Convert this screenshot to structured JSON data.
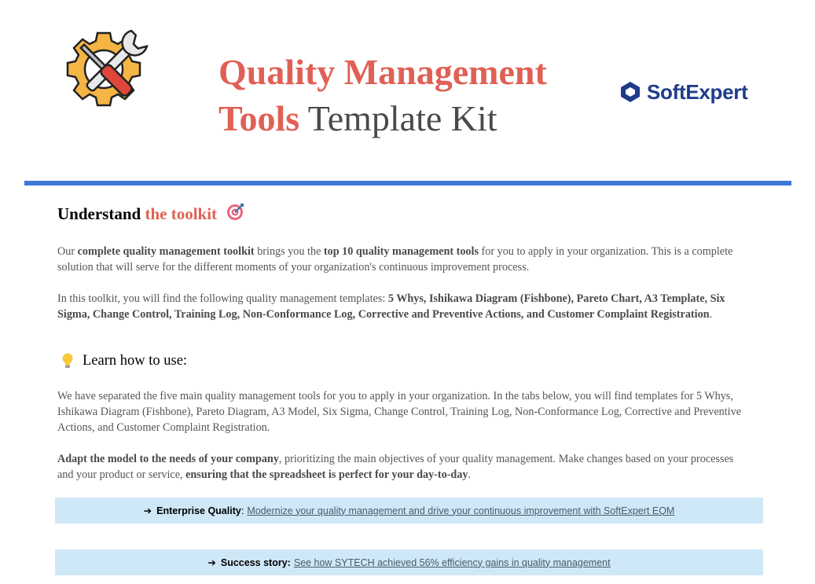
{
  "header": {
    "title_line1_red": "Quality Management",
    "title_line2_red": "Tools",
    "title_line2_gray": " Template Kit",
    "brand": "SoftExpert",
    "logo_icon": "gear-wrench-screwdriver-icon",
    "brand_icon": "softexpert-hexagon-icon"
  },
  "colors": {
    "accent_red": "#e06055",
    "divider_blue": "#3c78d8",
    "cta_bg": "#cfe8f7",
    "brand_blue": "#1f3c8a"
  },
  "section1": {
    "heading_black": "Understand ",
    "heading_red": "the toolkit",
    "heading_icon": "target-icon"
  },
  "p1": {
    "t1": "Our ",
    "b1": "complete quality management toolkit",
    "t2": " brings you the ",
    "b2": "top 10 quality management tools",
    "t3": " for you to apply in your organization. This is a complete solution that will serve for the different moments of your organization's continuous improvement process."
  },
  "p2": {
    "t1": "In this toolkit, you will find the following quality management templates: ",
    "b1": "5 Whys, Ishikawa Diagram (Fishbone), Pareto Chart, A3 Template, Six Sigma, Change Control, Training Log, Non-Conformance Log, Corrective and Preventive Actions, and Customer Complaint Registration",
    "t2": "."
  },
  "howto": {
    "label": "Learn how to use:",
    "icon": "lightbulb-icon"
  },
  "p3": {
    "text": "We have separated the five main quality management tools for you to apply in your organization. In the tabs below, you will find templates for 5 Whys, Ishikawa Diagram (Fishbone), Pareto Diagram, A3 Model, Six Sigma, Change Control, Training Log, Non-Conformance Log, Corrective and Preventive Actions, and Customer Complaint Registration."
  },
  "p4": {
    "b1": "Adapt the model to the needs of your company",
    "t1": ", prioritizing the main objectives of your quality management. Make changes based on your processes and your product or service, ",
    "b2": "ensuring that the spreadsheet is perfect for your day-to-day",
    "t2": "."
  },
  "cta1": {
    "arrow": "➔",
    "label": "Enterprise Quality",
    "sep": ":",
    "link": "Modernize your quality management and drive your continuous improvement with SoftExpert EQM"
  },
  "cta2": {
    "arrow": "➔",
    "label": "Success story:",
    "link": "See how SYTECH achieved 56% efficiency gains in quality management"
  }
}
